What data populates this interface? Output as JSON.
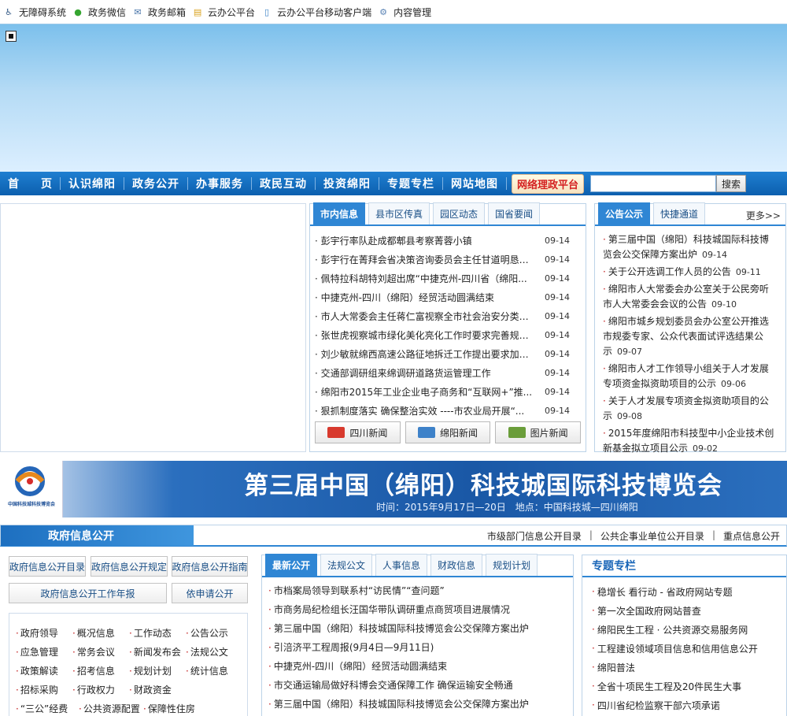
{
  "topbar": [
    {
      "label": "无障碍系统",
      "icon": "accessibility-icon",
      "color": "#3a5f8a"
    },
    {
      "label": "政务微信",
      "icon": "wechat-icon",
      "color": "#35a530"
    },
    {
      "label": "政务邮箱",
      "icon": "mail-icon",
      "color": "#4673a8"
    },
    {
      "label": "云办公平台",
      "icon": "chart-icon",
      "color": "#d9a21c"
    },
    {
      "label": "云办公平台移动客户端",
      "icon": "mobile-icon",
      "color": "#3d83c7"
    },
    {
      "label": "内容管理",
      "icon": "gear-icon",
      "color": "#5a83b5"
    }
  ],
  "nav": {
    "items": [
      "首　　页",
      "认识绵阳",
      "政务公开",
      "办事服务",
      "政民互动",
      "投资绵阳",
      "专题专栏",
      "网站地图"
    ],
    "special": "网络理政平台",
    "search_btn": "搜索"
  },
  "news": {
    "tabs": [
      "市内信息",
      "县市区传真",
      "园区动态",
      "国省要闻"
    ],
    "items": [
      {
        "t": "彭宇行率队赴成都郫县考察菁蓉小镇",
        "d": "09-14"
      },
      {
        "t": "彭宇行在菁拜会省决策咨询委员会主任甘道明恳请...",
        "d": "09-14"
      },
      {
        "t": "佩特拉科胡特刘超出席“中捷克州-四川省（绵阳...",
        "d": "09-14"
      },
      {
        "t": "中捷克州-四川（绵阳）经贸活动圆满结束",
        "d": "09-14"
      },
      {
        "t": "市人大常委会主任蒋仁富视察全市社会治安分类防...",
        "d": "09-14"
      },
      {
        "t": "张世虎视察城市绿化美化亮化工作时要求完善规划...",
        "d": "09-14"
      },
      {
        "t": "刘少敏就绵西高速公路征地拆迁工作提出要求加强...",
        "d": "09-14"
      },
      {
        "t": "交通部调研组来绵调研道路货运管理工作",
        "d": "09-14"
      },
      {
        "t": "绵阳市2015年工业企业电子商务和“互联网+”推...",
        "d": "09-14"
      },
      {
        "t": "狠抓制度落实 确保整治实效 ----市农业局开展“...",
        "d": "09-14"
      }
    ],
    "buttons": [
      "四川新闻",
      "绵阳新闻",
      "图片新闻"
    ]
  },
  "notice": {
    "tabs": [
      "公告公示",
      "快捷通道"
    ],
    "more": "更多>>",
    "items": [
      {
        "l1": "第三届中国（绵阳）科技城国际科技博",
        "l2": "览会公交保障方案出炉",
        "d": "09-14"
      },
      {
        "l1": "关于公开选调工作人员的公告",
        "l2": "",
        "d": "09-11"
      },
      {
        "l1": "绵阳市人大常委会办公室关于公民旁听",
        "l2": "市人大常委会会议的公告",
        "d": "09-10"
      },
      {
        "l1": "绵阳市城乡规划委员会办公室公开推选",
        "l2": "市规委专家、公众代表面试评选结果公",
        "l3": "示",
        "d": "09-07"
      },
      {
        "l1": "绵阳市人才工作领导小组关于人才发展",
        "l2": "专项资金拟资助项目的公示",
        "d": "09-06"
      },
      {
        "l1": "关于人才发展专项资金拟资助项目的公",
        "l2": "示",
        "d": "09-08"
      },
      {
        "l1": "2015年度绵阳市科技型中小企业技术创",
        "l2": "新基金拟立项目公示",
        "d": "09-02"
      }
    ]
  },
  "expo": {
    "title": "第三届中国（绵阳）科技城国际科技博览会",
    "sub": "时间：2015年9月17日—20日　地点：中国科技城—四川绵阳",
    "logo_text": "中国科技城科技博览会"
  },
  "gov": {
    "title": "政府信息公开",
    "links": [
      "市级部门信息公开目录",
      "公共企事业单位公开目录",
      "重点信息公开"
    ],
    "buttons": [
      "政府信息公开目录",
      "政府信息公开规定",
      "政府信息公开指南",
      "政府信息公开工作年报",
      "依申请公开"
    ],
    "grid": [
      [
        "政府领导",
        "概况信息",
        "工作动态",
        "公告公示"
      ],
      [
        "应急管理",
        "常务会议",
        "新闻发布会",
        "法规公文"
      ],
      [
        "政策解读",
        "招考信息",
        "规划计划",
        "统计信息"
      ],
      [
        "招标采购",
        "行政权力",
        "财政资金",
        ""
      ],
      [
        "“三公”经费",
        "公共资源配置",
        "保障性住房",
        ""
      ]
    ]
  },
  "latest": {
    "tabs": [
      "最新公开",
      "法规公文",
      "人事信息",
      "财政信息",
      "规划计划"
    ],
    "items": [
      "市档案局领导到联系村“访民情”“查问题”",
      "市商务局纪检组长汪国华带队调研重点商贸项目进展情况",
      "第三届中国（绵阳）科技城国际科技博览会公交保障方案出炉",
      "引涪济平工程周报(9月4日—9月11日)",
      "中捷克州-四川（绵阳）经贸活动圆满结束",
      "市交通运输局做好科博会交通保障工作 确保运输安全畅通",
      "第三届中国（绵阳）科技城国际科技博览会公交保障方案出炉"
    ]
  },
  "special": {
    "title": "专题专栏",
    "items": [
      "稳增长 看行动 - 省政府网站专题",
      "第一次全国政府网站普查",
      "绵阳民生工程  · 公共资源交易服务网",
      "工程建设领域项目信息和信用信息公开",
      "绵阳普法",
      "全省十项民生工程及20件民生大事",
      "四川省纪检监察干部六项承诺"
    ]
  }
}
